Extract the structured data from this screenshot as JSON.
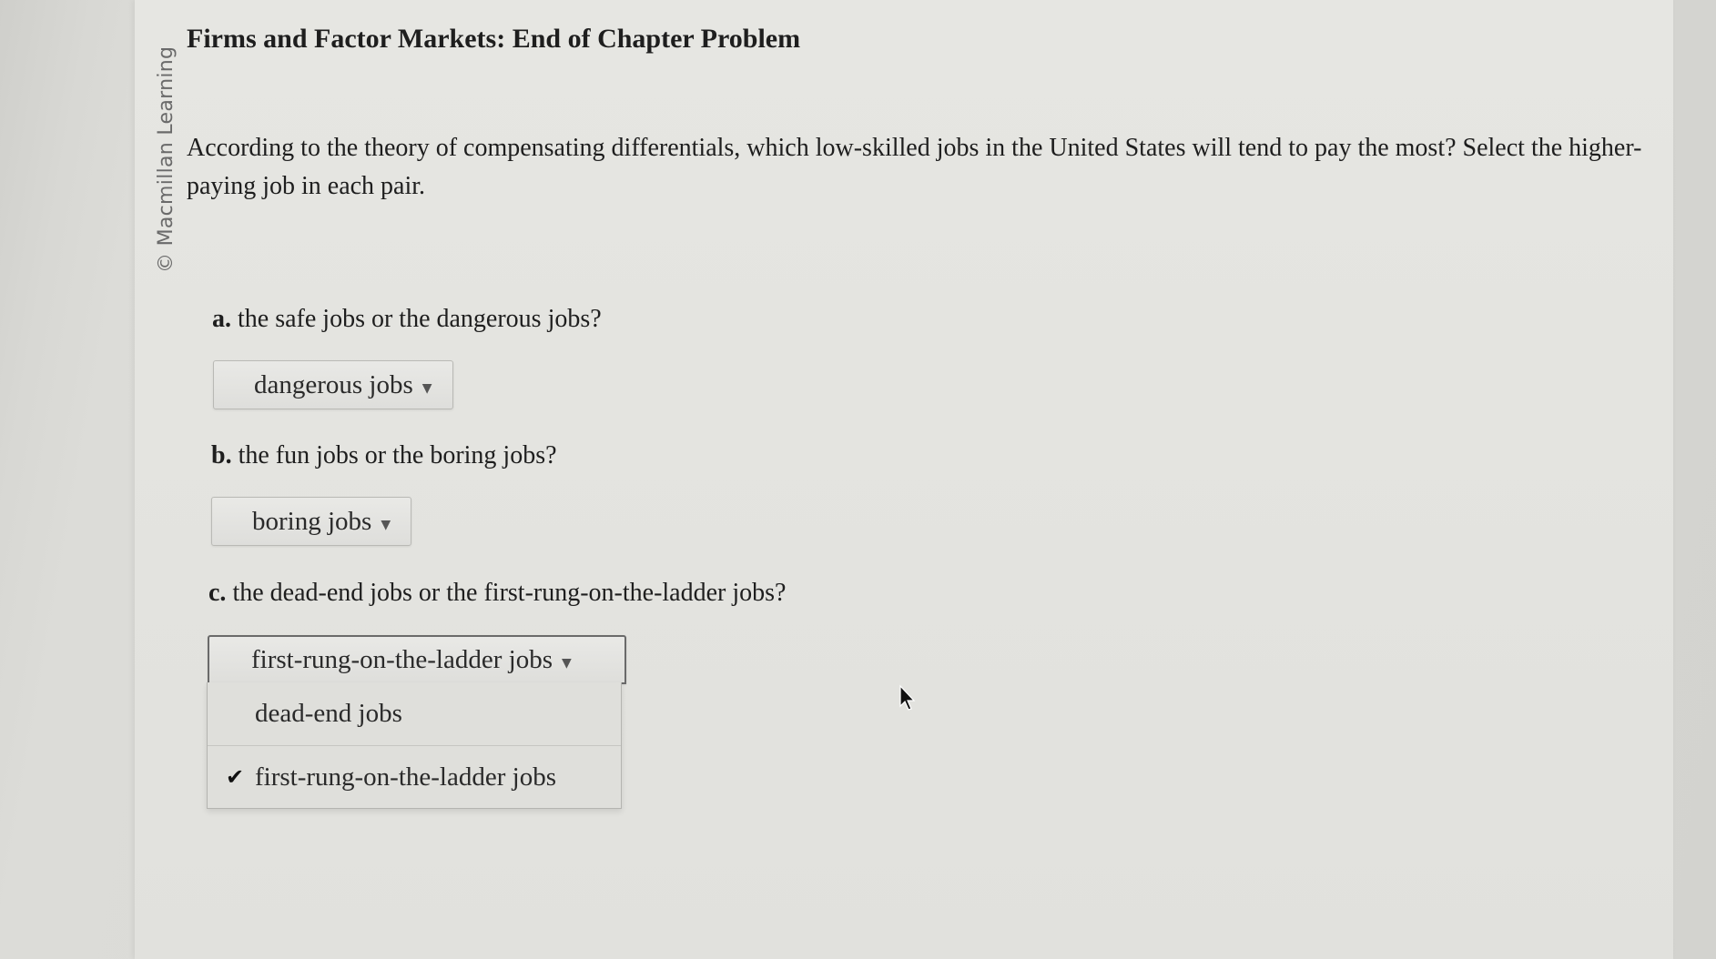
{
  "copyright": "© Macmillan Learning",
  "title": "Firms and Factor Markets: End of Chapter Problem",
  "prompt": "According to the theory of compensating differentials, which low-skilled jobs in the United States will tend to pay the most? Select the higher-paying job in each pair.",
  "questions": [
    {
      "letter": "a.",
      "text": "the safe jobs or the dangerous jobs?",
      "selected": "dangerous jobs"
    },
    {
      "letter": "b.",
      "text": "the fun jobs or the boring jobs?",
      "selected": "boring jobs"
    },
    {
      "letter": "c.",
      "text": "the dead-end jobs or the first-rung-on-the-ladder jobs?",
      "selected": "first-rung-on-the-ladder jobs",
      "options": [
        "dead-end jobs",
        "first-rung-on-the-ladder jobs"
      ]
    }
  ],
  "icons": {
    "caret": "chevron-down-icon",
    "check": "checkmark-icon",
    "cursor": "mouse-cursor-icon"
  }
}
